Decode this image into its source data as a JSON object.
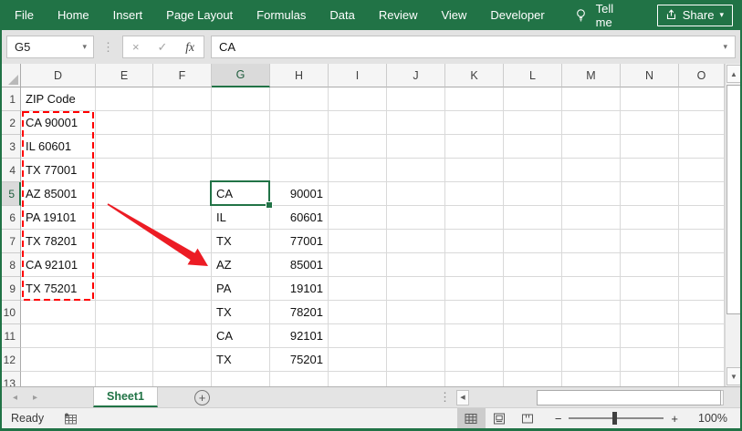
{
  "ribbon": {
    "tabs": [
      "File",
      "Home",
      "Insert",
      "Page Layout",
      "Formulas",
      "Data",
      "Review",
      "View",
      "Developer"
    ],
    "tell_me_label": "Tell me",
    "share_label": "Share"
  },
  "formula_bar": {
    "name_box_value": "G5",
    "input_value": "CA"
  },
  "grid": {
    "columns": [
      "D",
      "E",
      "F",
      "G",
      "H",
      "I",
      "J",
      "K",
      "L",
      "M",
      "N",
      "O"
    ],
    "selected": {
      "column": "G",
      "row": "5",
      "cell_ref": "G5"
    },
    "rows": [
      {
        "n": "1",
        "cells": {
          "D": "ZIP Code"
        }
      },
      {
        "n": "2",
        "cells": {
          "D": "CA 90001"
        }
      },
      {
        "n": "3",
        "cells": {
          "D": "IL 60601"
        }
      },
      {
        "n": "4",
        "cells": {
          "D": "TX 77001"
        }
      },
      {
        "n": "5",
        "cells": {
          "D": "AZ 85001",
          "G": "CA",
          "H": "90001"
        }
      },
      {
        "n": "6",
        "cells": {
          "D": "PA 19101",
          "G": "IL",
          "H": "60601"
        }
      },
      {
        "n": "7",
        "cells": {
          "D": "TX 78201",
          "G": "TX",
          "H": "77001"
        }
      },
      {
        "n": "8",
        "cells": {
          "D": "CA 92101",
          "G": "AZ",
          "H": "85001"
        }
      },
      {
        "n": "9",
        "cells": {
          "D": "TX 75201",
          "G": "PA",
          "H": "19101"
        }
      },
      {
        "n": "10",
        "cells": {
          "G": "TX",
          "H": "78201"
        }
      },
      {
        "n": "11",
        "cells": {
          "G": "CA",
          "H": "92101"
        }
      },
      {
        "n": "12",
        "cells": {
          "G": "TX",
          "H": "75201"
        }
      },
      {
        "n": "13",
        "cells": {}
      }
    ]
  },
  "sheet_bar": {
    "sheet_tab_label": "Sheet1"
  },
  "status_bar": {
    "ready_label": "Ready",
    "zoom_percent": "100%"
  },
  "colors": {
    "excel_green": "#217346",
    "selection_border": "#217346",
    "dashed_border_red": "#ff0000",
    "arrow_red": "#ec1c24",
    "header_selected_bg": "#dadada",
    "gridline": "#d9d9d9"
  },
  "icons": {
    "tell_me": "lightbulb-icon",
    "share": "share-box-arrow-icon",
    "record_macro": "macro-record-icon",
    "views": [
      "normal-view-icon",
      "page-layout-view-icon",
      "page-break-preview-icon"
    ]
  },
  "glyphs": {
    "dropdown": "▾",
    "cancel": "×",
    "enter": "✓",
    "fx": "fx",
    "scroll_up": "▲",
    "scroll_down": "▼",
    "scroll_left": "◀",
    "scroll_right": "▶",
    "tab_prev": "◂",
    "tab_next": "▸",
    "splitter_dots": "⋮",
    "minus": "−",
    "plus": "+",
    "add_sheet": "+"
  }
}
